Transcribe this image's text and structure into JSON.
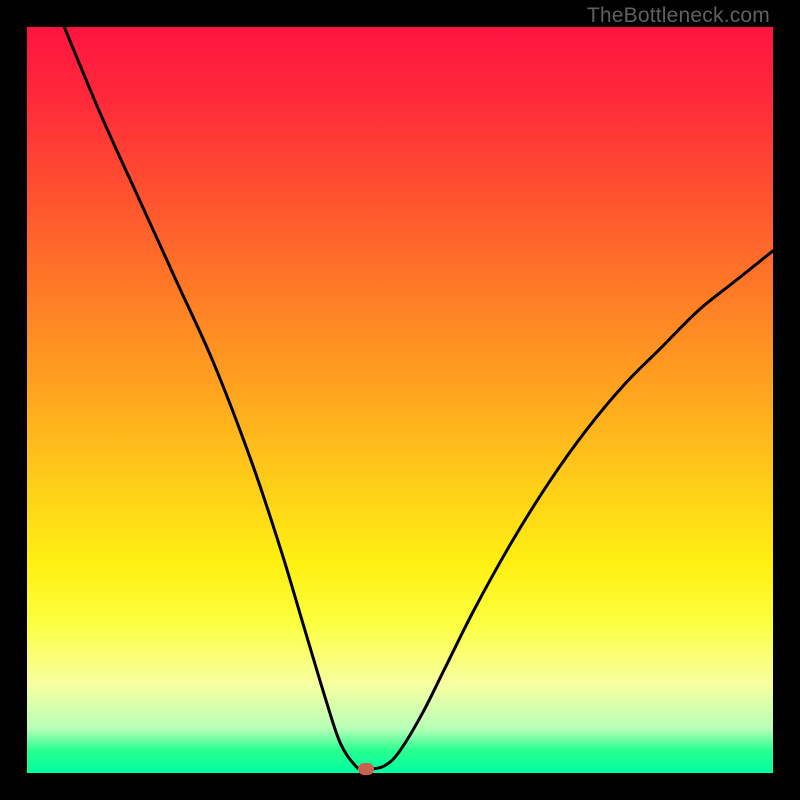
{
  "watermark": "TheBottleneck.com",
  "chart_data": {
    "type": "line",
    "title": "",
    "xlabel": "",
    "ylabel": "",
    "xlim": [
      0,
      100
    ],
    "ylim": [
      0,
      100
    ],
    "series": [
      {
        "name": "bottleneck-curve",
        "x": [
          5,
          10,
          15,
          20,
          25,
          30,
          34,
          37,
          40,
          42,
          44,
          45,
          46,
          48,
          50,
          53,
          56,
          60,
          65,
          70,
          75,
          80,
          85,
          90,
          95,
          100
        ],
        "y": [
          100,
          88,
          77,
          66,
          55,
          42,
          30,
          20,
          10,
          4,
          1,
          0.5,
          0.5,
          1,
          3,
          8,
          14,
          22,
          31,
          39,
          46,
          52,
          57,
          62,
          66,
          70
        ]
      }
    ],
    "minimum_point": {
      "x": 45.5,
      "y": 0.5
    },
    "gradient_stops": [
      {
        "pos": 0,
        "color": "#ff1440"
      },
      {
        "pos": 10,
        "color": "#ff2a3a"
      },
      {
        "pos": 22,
        "color": "#ff5030"
      },
      {
        "pos": 36,
        "color": "#ff7c26"
      },
      {
        "pos": 50,
        "color": "#ffa81e"
      },
      {
        "pos": 62,
        "color": "#ffd018"
      },
      {
        "pos": 72,
        "color": "#fff012"
      },
      {
        "pos": 80,
        "color": "#fbff40"
      },
      {
        "pos": 88,
        "color": "#f8ffa0"
      },
      {
        "pos": 94,
        "color": "#b8ffb8"
      },
      {
        "pos": 97,
        "color": "#28ff90"
      },
      {
        "pos": 100,
        "color": "#00ffa0"
      }
    ]
  }
}
